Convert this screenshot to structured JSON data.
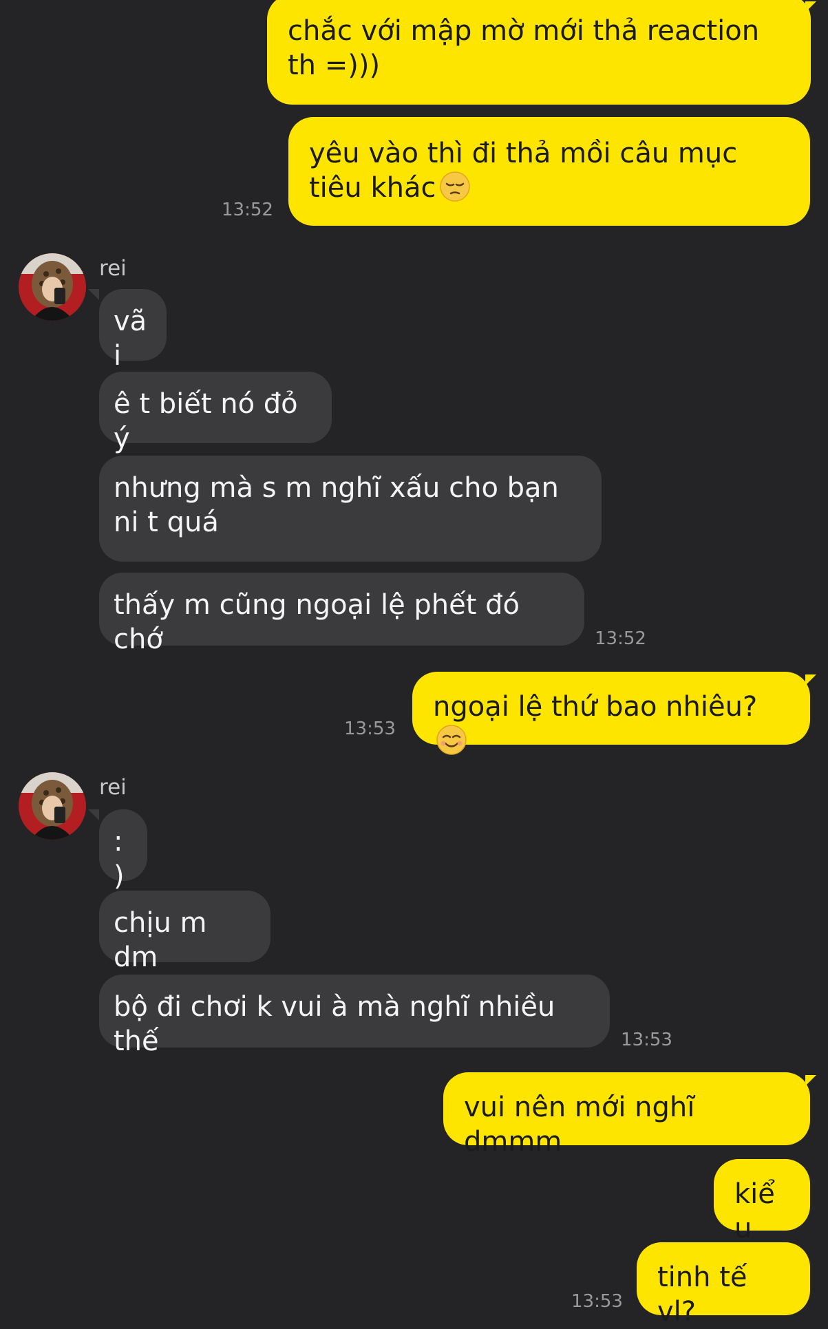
{
  "contact": {
    "name": "rei"
  },
  "messages": [
    {
      "from": "me",
      "text": "chắc với mập mờ mới thả reaction th =)))"
    },
    {
      "from": "me",
      "text": "yêu vào thì đi thả mồi câu mục tiêu khác",
      "emoji": "pensive-face-icon",
      "time": "13:52"
    },
    {
      "from": "them",
      "text": "vãi"
    },
    {
      "from": "them",
      "text": "ê t biết nó đỏ ý"
    },
    {
      "from": "them",
      "text": "nhưng mà s m nghĩ xấu cho bạn ni t quá"
    },
    {
      "from": "them",
      "text": "thấy m cũng ngoại lệ phết đó chớ",
      "time": "13:52"
    },
    {
      "from": "me",
      "text": "ngoại lệ thứ bao nhiêu?",
      "emoji": "smiling-face-icon",
      "time": "13:53"
    },
    {
      "from": "them",
      "text": ":)"
    },
    {
      "from": "them",
      "text": "chịu m dm"
    },
    {
      "from": "them",
      "text": "bộ đi chơi k vui à mà nghĩ nhiều thế",
      "time": "13:53"
    },
    {
      "from": "me",
      "text": "vui nên mới nghĩ dmmm"
    },
    {
      "from": "me",
      "text": "kiểu"
    },
    {
      "from": "me",
      "text": "tinh tế vl?",
      "time": "13:53"
    }
  ],
  "colors": {
    "background": "#242426",
    "my_bubble": "#fee500",
    "their_bubble": "#3b3b3e",
    "timestamp": "#9a9a9c"
  }
}
